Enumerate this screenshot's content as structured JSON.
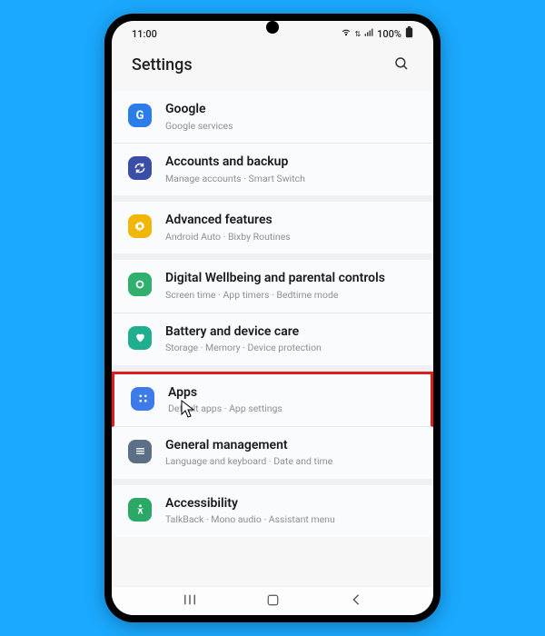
{
  "status": {
    "time": "11:00",
    "battery": "100%"
  },
  "header": {
    "title": "Settings"
  },
  "items": [
    {
      "title": "Google",
      "sub": "Google services",
      "bg": "#2b7de9",
      "glyph": "G"
    },
    {
      "title": "Accounts and backup",
      "sub": "Manage accounts · Smart Switch",
      "bg": "#3a4ea8",
      "glyph": "sync"
    },
    {
      "title": "Advanced features",
      "sub": "Android Auto · Bixby Routines",
      "bg": "#f2b705",
      "glyph": "gear"
    },
    {
      "title": "Digital Wellbeing and parental controls",
      "sub": "Screen time · App timers · Bedtime mode",
      "bg": "#2fb06d",
      "glyph": "ring"
    },
    {
      "title": "Battery and device care",
      "sub": "Storage · Memory · Device protection",
      "bg": "#1fae8e",
      "glyph": "heart"
    },
    {
      "title": "Apps",
      "sub": "Default apps · App settings",
      "bg": "#3d7ce8",
      "glyph": "grid"
    },
    {
      "title": "General management",
      "sub": "Language and keyboard · Date and time",
      "bg": "#5b6f86",
      "glyph": "bars"
    },
    {
      "title": "Accessibility",
      "sub": "TalkBack · Mono audio · Assistant menu",
      "bg": "#2aa866",
      "glyph": "person"
    }
  ]
}
